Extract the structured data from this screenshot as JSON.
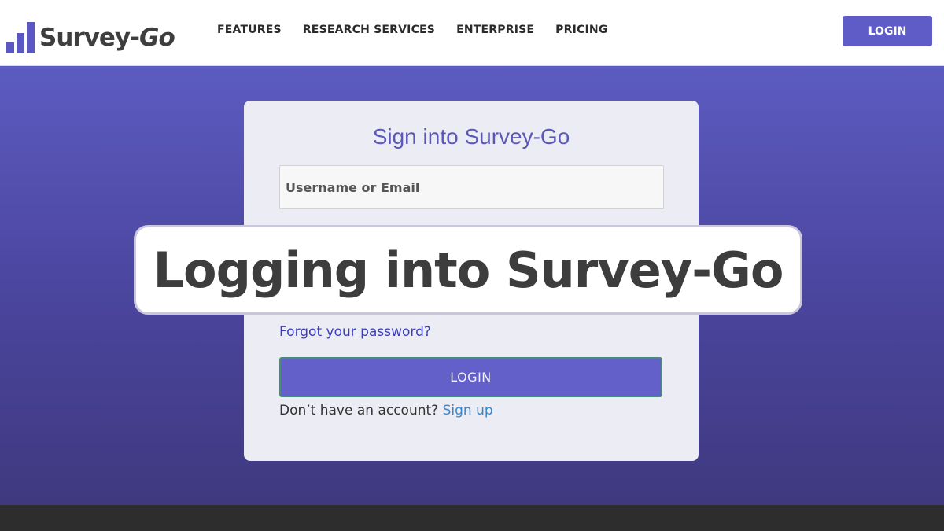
{
  "header": {
    "logo": {
      "icon": "bar-chart-icon",
      "text_main": "Survey-",
      "text_accent": "Go"
    },
    "nav": [
      "FEATURES",
      "RESEARCH SERVICES",
      "ENTERPRISE",
      "PRICING"
    ],
    "login_label": "LOGIN"
  },
  "card": {
    "title": "Sign into Survey-Go",
    "username_placeholder": "Username or Email",
    "forgot_label": "Forgot your password?",
    "login_label": "LOGIN",
    "signup_prompt": "Don’t have an account?",
    "signup_link": "Sign up"
  },
  "banner": {
    "text": "Logging into Survey-Go"
  },
  "colors": {
    "accent": "#5f5cc8",
    "hero_top": "#5c5bc0",
    "hero_bottom": "#3f397f",
    "card_bg": "#ececf4",
    "link": "#3b3bbf",
    "signup_link": "#3a86c8",
    "footer": "#2d2d2d"
  }
}
